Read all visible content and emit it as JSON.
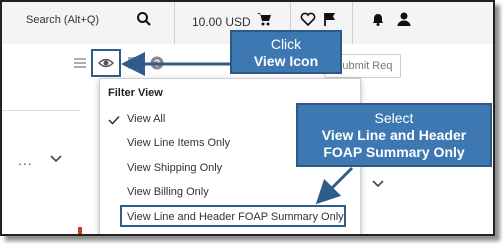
{
  "header": {
    "search_text": "Search (Alt+Q)",
    "cart_amount": "10.00 USD",
    "icons": [
      "search-icon",
      "cart-icon",
      "heart-icon",
      "flag-icon",
      "bell-icon",
      "user-icon"
    ]
  },
  "toolbar": {
    "icons": [
      "list-icon",
      "eye-icon",
      "print-icon",
      "help-icon"
    ],
    "more": "...",
    "submit_label": "Submit Req"
  },
  "left_panel": {
    "more": "..."
  },
  "filter_view": {
    "title": "Filter View",
    "items": [
      {
        "label": "View All",
        "selected": true
      },
      {
        "label": "View Line Items Only",
        "selected": false
      },
      {
        "label": "View Shipping Only",
        "selected": false
      },
      {
        "label": "View Billing Only",
        "selected": false
      },
      {
        "label": "View Line and Header FOAP Summary Only",
        "selected": false
      }
    ]
  },
  "callouts": {
    "click": {
      "line1": "Click",
      "line2": "View Icon"
    },
    "select": {
      "line1": "Select",
      "line2": "View Line and Header",
      "line3": "FOAP Summary Only"
    }
  },
  "colors": {
    "callout": "#3e78b2",
    "highlight_border": "#2f5d8a"
  }
}
